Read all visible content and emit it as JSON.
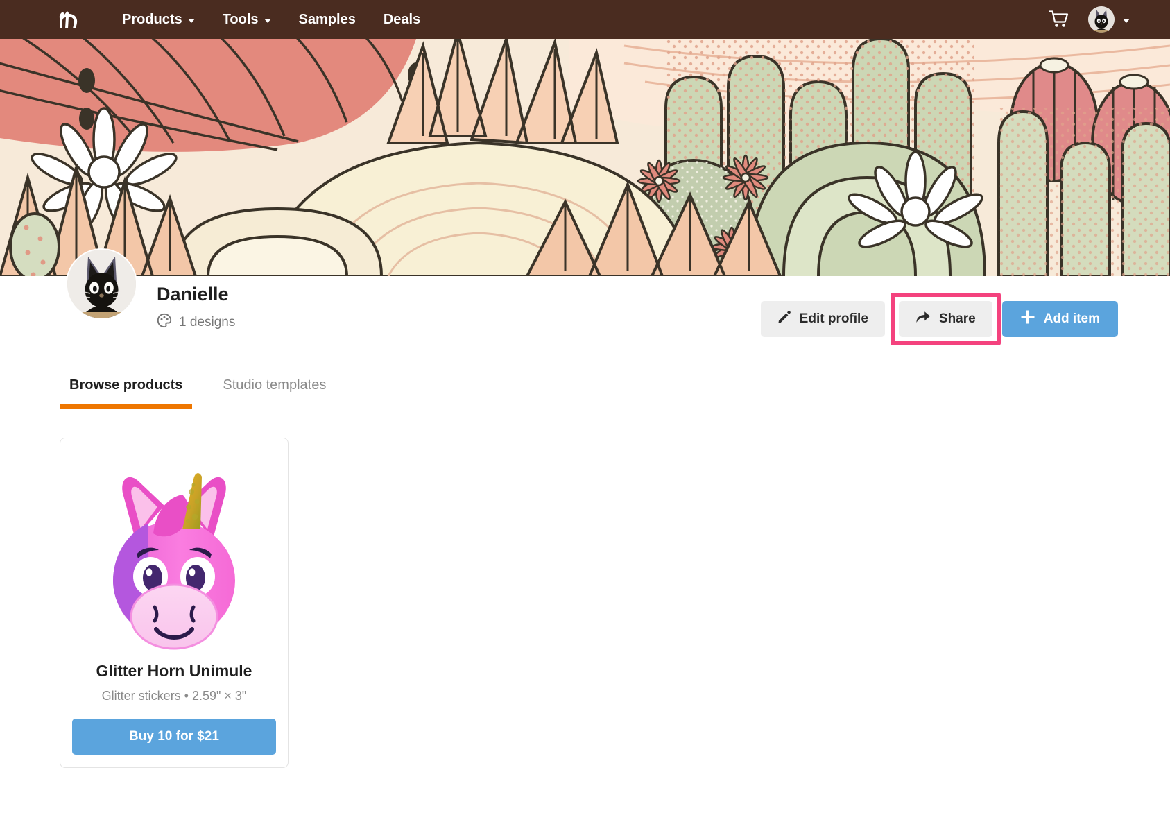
{
  "nav": {
    "logo_icon": "horse-logo-icon",
    "links": [
      {
        "label": "Products",
        "has_caret": true
      },
      {
        "label": "Tools",
        "has_caret": true
      },
      {
        "label": "Samples",
        "has_caret": false
      },
      {
        "label": "Deals",
        "has_caret": false
      }
    ],
    "cart_icon": "shopping-cart-icon",
    "account_icon": "user-avatar-icon",
    "account_caret_icon": "chevron-down-icon",
    "bar_color": "#4a2c20"
  },
  "banner": {
    "alt": "cactus-succulent-illustration-banner",
    "colors": {
      "cream": "#f7f0dc",
      "peach": "#f6cfaf",
      "coral": "#e98d80",
      "rose": "#e27d7d",
      "sage": "#c3cfa8",
      "sage_light": "#d7e0c2",
      "outline": "#3a3328",
      "white": "#ffffff"
    }
  },
  "profile": {
    "avatar_icon": "black-cat-avatar",
    "name": "Danielle",
    "designs_icon": "palette-icon",
    "designs_count": "1 designs",
    "buttons": {
      "edit_profile": {
        "label": "Edit profile",
        "icon": "pencil-icon"
      },
      "share": {
        "label": "Share",
        "icon": "share-arrow-icon",
        "highlighted": true,
        "highlight_color": "#f4427e"
      },
      "add_item": {
        "label": "Add item",
        "icon": "plus-icon",
        "color": "#5ba4dd"
      }
    }
  },
  "tabs": [
    {
      "label": "Browse products",
      "active": true
    },
    {
      "label": "Studio templates",
      "active": false
    }
  ],
  "tab_accent_color": "#ee7600",
  "products": [
    {
      "image_icon": "pink-unicorn-sticker",
      "title": "Glitter Horn Unimule",
      "subtitle": "Glitter stickers • 2.59\" × 3\"",
      "buy_label": "Buy 10 for $21",
      "buy_color": "#5ba4dd"
    }
  ]
}
